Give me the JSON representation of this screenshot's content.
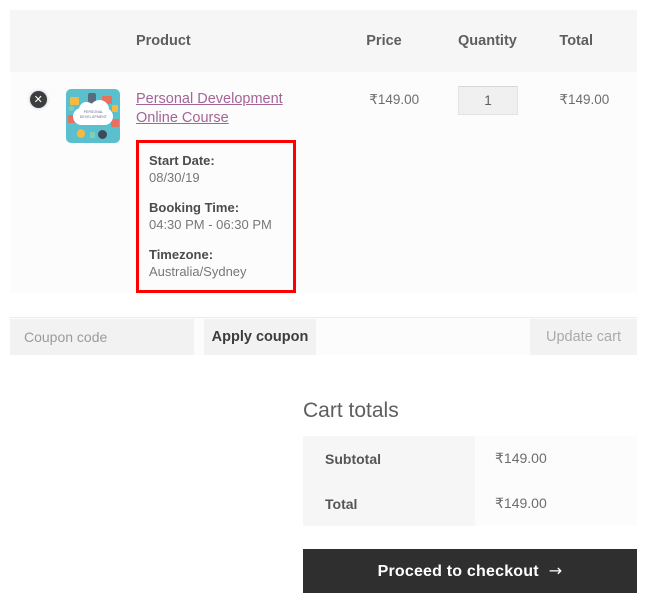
{
  "cart_table": {
    "headers": {
      "remove": "",
      "thumbnail": "",
      "product": "Product",
      "price": "Price",
      "quantity": "Quantity",
      "total": "Total"
    },
    "rows": [
      {
        "remove_label": "✕",
        "thumbnail_alt": "Personal Development course thumbnail",
        "thumbnail_caption": "PERSONAL DEVELOPMENT",
        "product_name": "Personal Development Online Course",
        "booking": {
          "start_date_label": "Start Date:",
          "start_date_value": "08/30/19",
          "booking_time_label": "Booking Time:",
          "booking_time_value": "04:30 PM - 06:30 PM",
          "timezone_label": "Timezone:",
          "timezone_value": "Australia/Sydney"
        },
        "price": "₹149.00",
        "quantity": "1",
        "total": "₹149.00"
      }
    ]
  },
  "coupon": {
    "placeholder": "Coupon code",
    "value": "",
    "apply_label": "Apply coupon",
    "update_cart_label": "Update cart"
  },
  "cart_totals": {
    "title": "Cart totals",
    "rows": [
      {
        "label": "Subtotal",
        "value": "₹149.00"
      },
      {
        "label": "Total",
        "value": "₹149.00"
      }
    ],
    "checkout_label": "Proceed to checkout",
    "checkout_arrow": "→"
  },
  "colors": {
    "highlight_border": "#fe0000",
    "link": "#a46497",
    "checkout_bg": "#2f2f2f",
    "header_bg": "#f6f6f6",
    "thumbnail_bg": "#5bc0ce"
  }
}
